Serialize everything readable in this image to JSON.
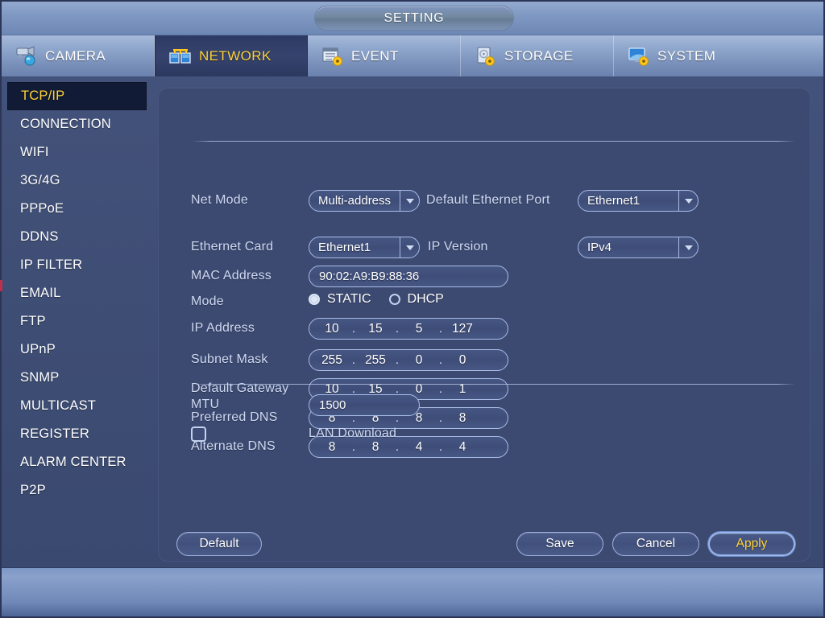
{
  "window": {
    "title": "SETTING"
  },
  "tabs": [
    {
      "label": "CAMERA",
      "icon": "camera-icon",
      "active": false
    },
    {
      "label": "NETWORK",
      "icon": "network-icon",
      "active": true
    },
    {
      "label": "EVENT",
      "icon": "event-icon",
      "active": false
    },
    {
      "label": "STORAGE",
      "icon": "storage-icon",
      "active": false
    },
    {
      "label": "SYSTEM",
      "icon": "system-icon",
      "active": false
    }
  ],
  "sidebar": {
    "items": [
      {
        "label": "TCP/IP",
        "active": true
      },
      {
        "label": "CONNECTION",
        "active": false
      },
      {
        "label": "WIFI",
        "active": false
      },
      {
        "label": "3G/4G",
        "active": false
      },
      {
        "label": "PPPoE",
        "active": false
      },
      {
        "label": "DDNS",
        "active": false
      },
      {
        "label": "IP FILTER",
        "active": false
      },
      {
        "label": "EMAIL",
        "active": false
      },
      {
        "label": "FTP",
        "active": false
      },
      {
        "label": "UPnP",
        "active": false
      },
      {
        "label": "SNMP",
        "active": false
      },
      {
        "label": "MULTICAST",
        "active": false
      },
      {
        "label": "REGISTER",
        "active": false
      },
      {
        "label": "ALARM CENTER",
        "active": false
      },
      {
        "label": "P2P",
        "active": false
      }
    ]
  },
  "form": {
    "net_mode_label": "Net Mode",
    "net_mode_value": "Multi-address",
    "default_ethernet_port_label": "Default Ethernet Port",
    "default_ethernet_port_value": "Ethernet1",
    "ethernet_card_label": "Ethernet Card",
    "ethernet_card_value": "Ethernet1",
    "ip_version_label": "IP Version",
    "ip_version_value": "IPv4",
    "mac_address_label": "MAC Address",
    "mac_address_value": "90:02:A9:B9:88:36",
    "mode_label": "Mode",
    "mode_static_label": "STATIC",
    "mode_dhcp_label": "DHCP",
    "mode_selected": "STATIC",
    "ip_address_label": "IP Address",
    "ip_address_octets": [
      "10",
      "15",
      "5",
      "127"
    ],
    "subnet_mask_label": "Subnet Mask",
    "subnet_mask_octets": [
      "255",
      "255",
      "0",
      "0"
    ],
    "default_gateway_label": "Default Gateway",
    "default_gateway_octets": [
      "10",
      "15",
      "0",
      "1"
    ],
    "preferred_dns_label": "Preferred DNS",
    "preferred_dns_octets": [
      "8",
      "8",
      "8",
      "8"
    ],
    "alternate_dns_label": "Alternate DNS",
    "alternate_dns_octets": [
      "8",
      "8",
      "4",
      "4"
    ],
    "mtu_label": "MTU",
    "mtu_value": "1500",
    "lan_download_label": "LAN Download",
    "lan_download_checked": false
  },
  "buttons": {
    "default_label": "Default",
    "save_label": "Save",
    "cancel_label": "Cancel",
    "apply_label": "Apply",
    "apply_focused": true
  },
  "colors": {
    "accent_yellow": "#ffd33a",
    "panel_bg": "#3c4a72",
    "label_blue": "#cfd9f2",
    "active_tab_bg": "#2c3a63"
  }
}
